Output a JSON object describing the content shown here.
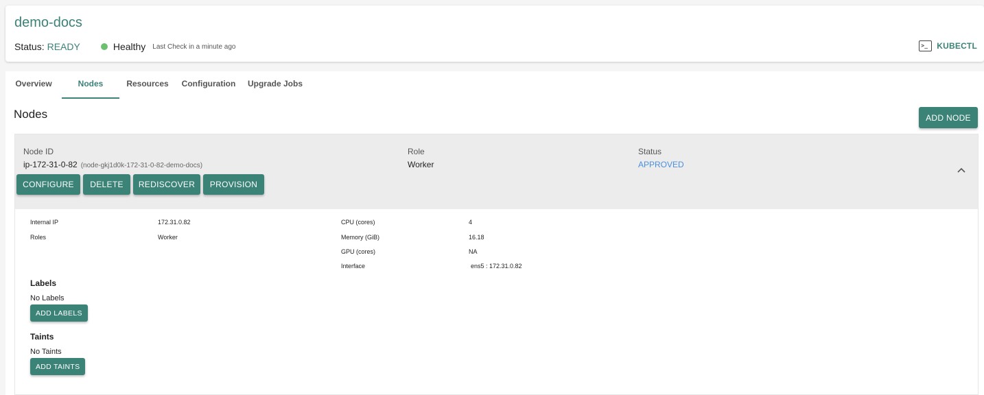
{
  "header": {
    "cluster_name": "demo-docs",
    "status_label": "Status:",
    "status_value": "READY",
    "health": "Healthy",
    "last_check": "Last Check in a minute ago",
    "kubectl_label": "KUBECTL",
    "kubectl_icon": "terminal-icon",
    "health_color": "#6cc070"
  },
  "tabs": [
    {
      "label": "Overview",
      "active": false
    },
    {
      "label": "Nodes",
      "active": true
    },
    {
      "label": "Resources",
      "active": false
    },
    {
      "label": "Configuration",
      "active": false
    },
    {
      "label": "Upgrade Jobs",
      "active": false
    }
  ],
  "nodes_section": {
    "title": "Nodes",
    "add_node_label": "ADD NODE"
  },
  "node": {
    "id_label": "Node ID",
    "id_value": "ip-172-31-0-82",
    "id_sub": "(node-gkj1d0k-172-31-0-82-demo-docs)",
    "role_label": "Role",
    "role_value": "Worker",
    "status_label": "Status",
    "status_value": "APPROVED",
    "actions": [
      "CONFIGURE",
      "DELETE",
      "REDISCOVER",
      "PROVISION"
    ],
    "expand_icon": "chevron-up-icon",
    "details": {
      "internal_ip_label": "Internal IP",
      "internal_ip_value": "172.31.0.82",
      "roles_label": "Roles",
      "roles_value": "Worker",
      "cpu_label": "CPU (cores)",
      "cpu_value": "4",
      "memory_label": "Memory (GiB)",
      "memory_value": "16.18",
      "gpu_label": "GPU (cores)",
      "gpu_value": "NA",
      "interface_label": "Interface",
      "interface_value": "ens5 : 172.31.0.82"
    },
    "labels_title": "Labels",
    "labels_text": "No Labels",
    "add_labels": "ADD LABELS",
    "taints_title": "Taints",
    "taints_text": "No Taints",
    "add_taints": "ADD TAINTS"
  },
  "colors": {
    "accent": "#3b8277",
    "approved": "#4a8fe0"
  }
}
